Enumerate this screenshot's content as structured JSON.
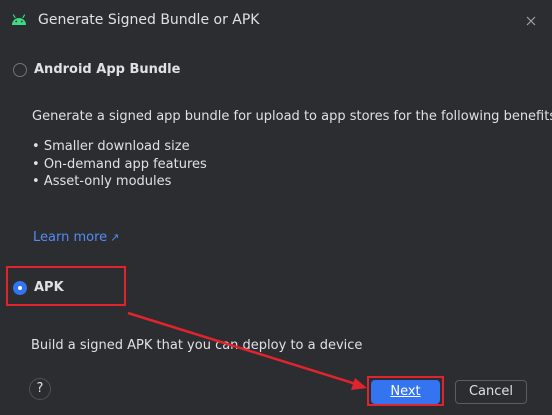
{
  "dialog": {
    "title": "Generate Signed Bundle or APK",
    "icon": "android-icon",
    "close_icon": "close-icon"
  },
  "options": {
    "bundle": {
      "label": "Android App Bundle",
      "selected": false,
      "description": "Generate a signed app bundle for upload to app stores for the following benefits:",
      "benefits": [
        "Smaller download size",
        "On-demand app features",
        "Asset-only modules"
      ],
      "learn_more": "Learn more",
      "learn_more_icon": "external-link-arrow-icon"
    },
    "apk": {
      "label": "APK",
      "selected": true,
      "description": "Build a signed APK that you can deploy to a device"
    }
  },
  "footer": {
    "help": "?",
    "next": "Next",
    "cancel": "Cancel"
  },
  "colors": {
    "background": "#2b2d30",
    "accent": "#3574f0",
    "link": "#548af7",
    "annotation": "#e0242e"
  }
}
